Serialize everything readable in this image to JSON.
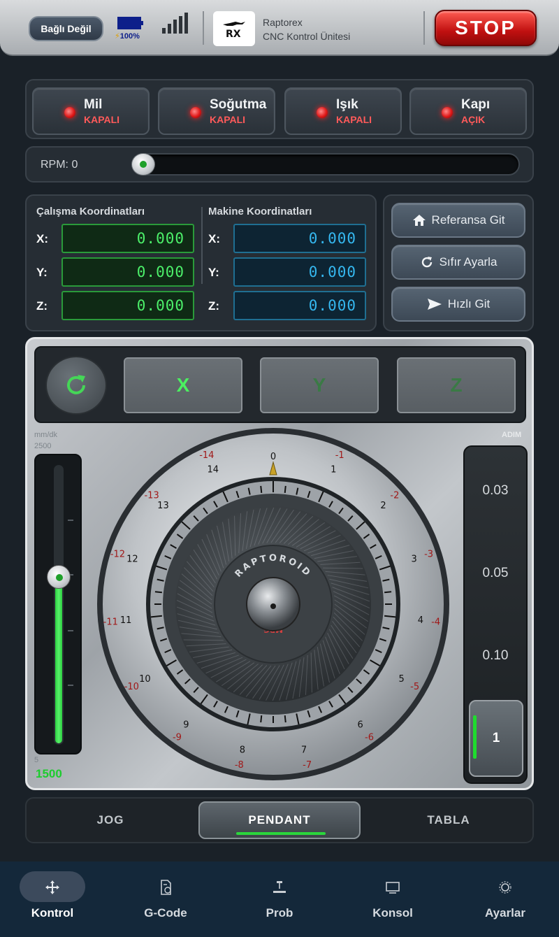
{
  "header": {
    "connection_status": "Bağlı Değil",
    "battery_text": "100%",
    "brand_name": "Raptorex",
    "brand_subtitle": "CNC Kontrol Ünitesi",
    "stop_label": "STOP"
  },
  "toggles": [
    {
      "name": "Mil",
      "state": "KAPALI"
    },
    {
      "name": "Soğutma",
      "state": "KAPALI"
    },
    {
      "name": "Işık",
      "state": "KAPALI"
    },
    {
      "name": "Kapı",
      "state": "AÇIK"
    }
  ],
  "rpm": {
    "label": "RPM: 0",
    "value": 0
  },
  "coordinates": {
    "work_title": "Çalışma Koordinatları",
    "machine_title": "Makine Koordinatları",
    "axes": [
      {
        "label": "X:",
        "work": "0.000",
        "machine": "0.000"
      },
      {
        "label": "Y:",
        "work": "0.000",
        "machine": "0.000"
      },
      {
        "label": "Z:",
        "work": "0.000",
        "machine": "0.000"
      }
    ]
  },
  "side_buttons": [
    {
      "label": "Referansa Git",
      "icon": "home-icon"
    },
    {
      "label": "Sıfır Ayarla",
      "icon": "refresh-icon"
    },
    {
      "label": "Hızlı Git",
      "icon": "send-icon"
    }
  ],
  "pendant": {
    "axis_buttons": [
      "X",
      "Y",
      "Z"
    ],
    "active_axis": "X",
    "speed_unit": "mm/dk",
    "speed_max": "2500",
    "speed_min": "5",
    "speed_value": "1500",
    "speed_fraction": 0.6,
    "step_label": "ADIM",
    "step_options": [
      "0.03",
      "0.05",
      "0.10"
    ],
    "step_active": "1",
    "wheel_brand": "RAPTOROID",
    "wheel_sub": "MPG",
    "outer_numbers": [
      "0",
      "-14",
      "-13",
      "-12",
      "-11",
      "-10",
      "-9",
      "-8",
      "-7",
      "-6",
      "-5",
      "-4",
      "-3",
      "-2",
      "-1"
    ],
    "inner_numbers": [
      "0",
      "1",
      "2",
      "3",
      "4",
      "5",
      "6",
      "7",
      "8",
      "9",
      "10",
      "11",
      "12",
      "13",
      "14"
    ]
  },
  "modes": {
    "tabs": [
      "JOG",
      "PENDANT",
      "TABLA"
    ],
    "active": "PENDANT"
  },
  "bottom_nav": [
    {
      "label": "Kontrol",
      "icon": "move-icon"
    },
    {
      "label": "G-Code",
      "icon": "gcode-file-icon"
    },
    {
      "label": "Prob",
      "icon": "probe-icon"
    },
    {
      "label": "Konsol",
      "icon": "console-icon"
    },
    {
      "label": "Ayarlar",
      "icon": "gear-icon"
    }
  ],
  "colors": {
    "accent_green": "#2bd63c",
    "stop_red": "#d01818",
    "work_coord": "#4cf06a",
    "machine_coord": "#35b8f0"
  }
}
